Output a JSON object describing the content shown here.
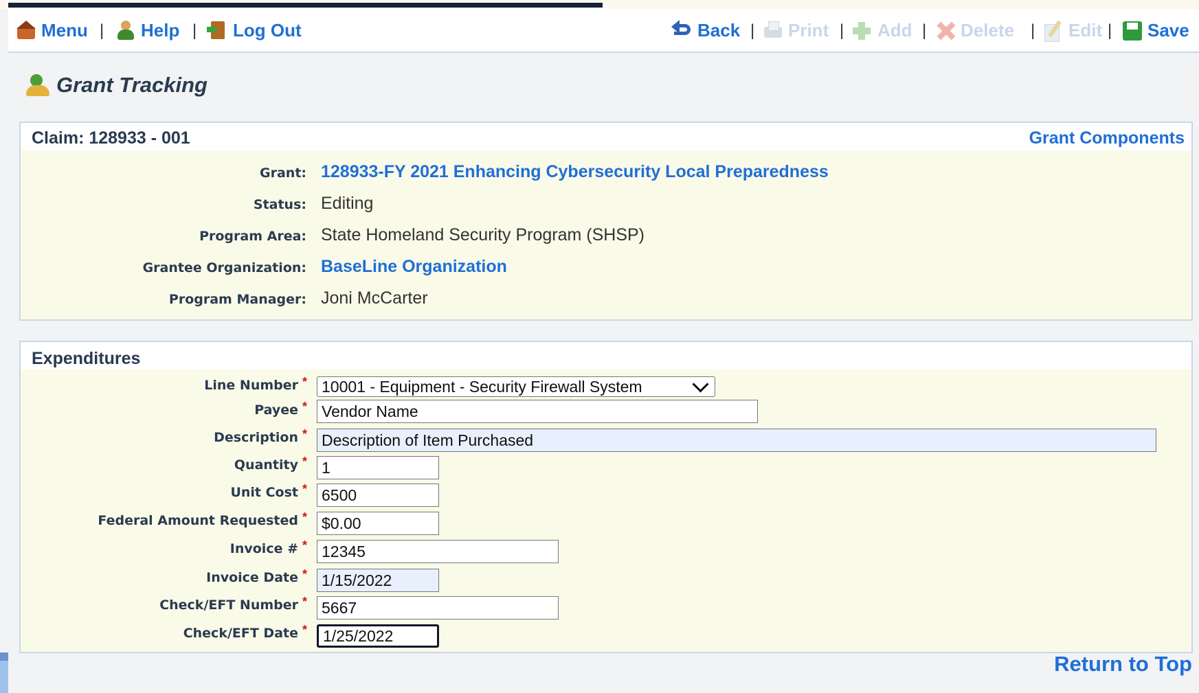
{
  "toolbar": {
    "menu": "Menu",
    "help": "Help",
    "logout": "Log Out",
    "back": "Back",
    "print": "Print",
    "add": "Add",
    "delete": "Delete",
    "edit": "Edit",
    "save": "Save",
    "separator": "|"
  },
  "page": {
    "title": "Grant Tracking"
  },
  "claim": {
    "label": "Claim: 128933 - 001",
    "components_link": "Grant Components",
    "fields": {
      "grant_label": "Grant:",
      "grant_value": "128933-FY 2021 Enhancing Cybersecurity Local Preparedness",
      "status_label": "Status:",
      "status_value": "Editing",
      "program_area_label": "Program Area:",
      "program_area_value": "State Homeland Security Program (SHSP)",
      "grantee_label": "Grantee Organization:",
      "grantee_value": "BaseLine Organization",
      "manager_label": "Program Manager:",
      "manager_value": "Joni McCarter"
    }
  },
  "expenditures": {
    "title": "Expenditures",
    "required_mark": "*",
    "line_number": {
      "label": "Line Number",
      "value": "10001 - Equipment - Security Firewall System"
    },
    "payee": {
      "label": "Payee",
      "value": "Vendor Name"
    },
    "description": {
      "label": "Description",
      "value": "Description of Item Purchased"
    },
    "quantity": {
      "label": "Quantity",
      "value": "1"
    },
    "unit_cost": {
      "label": "Unit Cost",
      "value": "6500"
    },
    "federal_amount": {
      "label": "Federal Amount Requested",
      "value": "$0.00"
    },
    "invoice_number": {
      "label": "Invoice #",
      "value": "12345"
    },
    "invoice_date": {
      "label": "Invoice Date",
      "value": "1/15/2022"
    },
    "check_number": {
      "label": "Check/EFT Number",
      "value": "5667"
    },
    "check_date": {
      "label": "Check/EFT Date",
      "value": "1/25/2022"
    }
  },
  "footer": {
    "return_top": "Return to Top"
  },
  "colors": {
    "link": "#1f6fd6",
    "panel_bg": "#fafae9",
    "required": "#d01818"
  }
}
